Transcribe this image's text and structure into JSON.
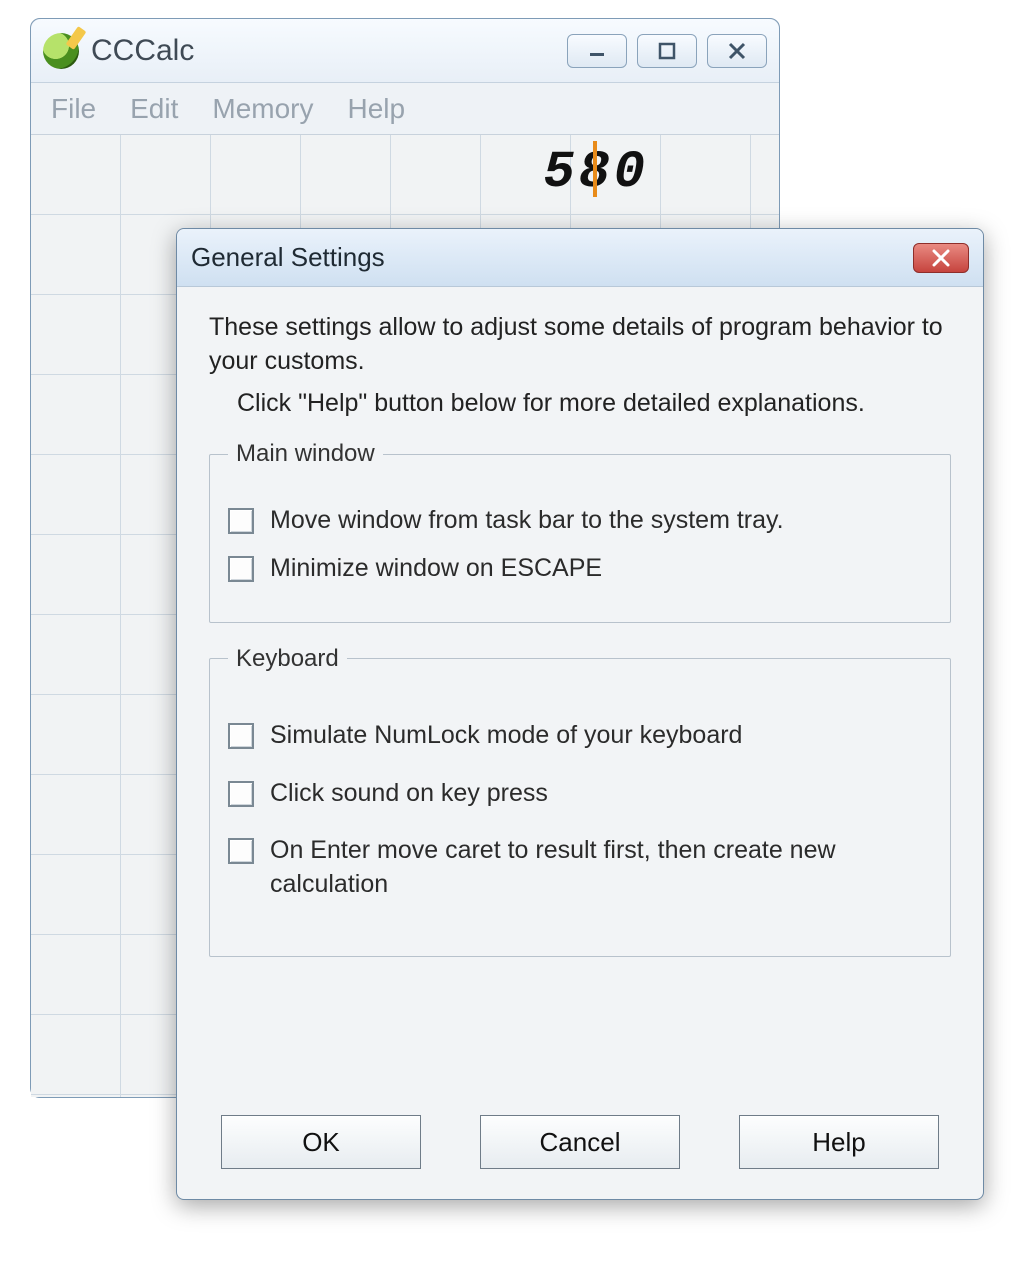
{
  "main_window": {
    "title": "CCCalc",
    "menu": {
      "file": "File",
      "edit": "Edit",
      "memory": "Memory",
      "help": "Help"
    },
    "display_value": "580"
  },
  "dialog": {
    "title": "General Settings",
    "intro_line1": "These settings allow to adjust some details of program behavior to your customs.",
    "intro_line2": "Click \"Help\" button below for more detailed explanations.",
    "group_main": {
      "legend": "Main window",
      "opt_tray": "Move window from task bar to the system tray.",
      "opt_escape": "Minimize window on ESCAPE"
    },
    "group_keyboard": {
      "legend": "Keyboard",
      "opt_numlock": "Simulate NumLock mode of your keyboard",
      "opt_click": "Click sound on key press",
      "opt_enter": "On Enter move caret to result first, then create new calculation"
    },
    "buttons": {
      "ok": "OK",
      "cancel": "Cancel",
      "help": "Help"
    }
  }
}
